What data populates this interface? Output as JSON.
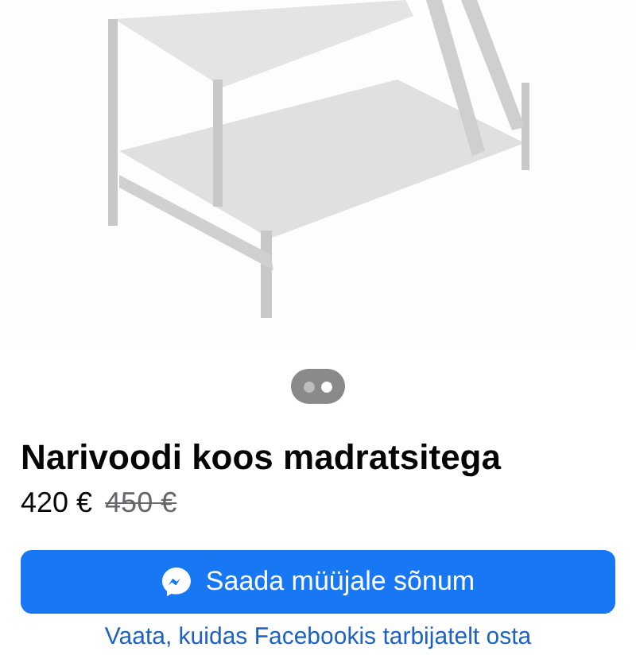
{
  "carousel_dots": [
    {
      "selected": false
    },
    {
      "selected": true
    }
  ],
  "listing": {
    "title": "Narivoodi koos madratsitega",
    "price": "420 €",
    "old_price": "450 €"
  },
  "message_button": {
    "label": "Saada müüjale sõnum"
  },
  "help_link": "Vaata, kuidas Facebookis tarbijatelt osta"
}
